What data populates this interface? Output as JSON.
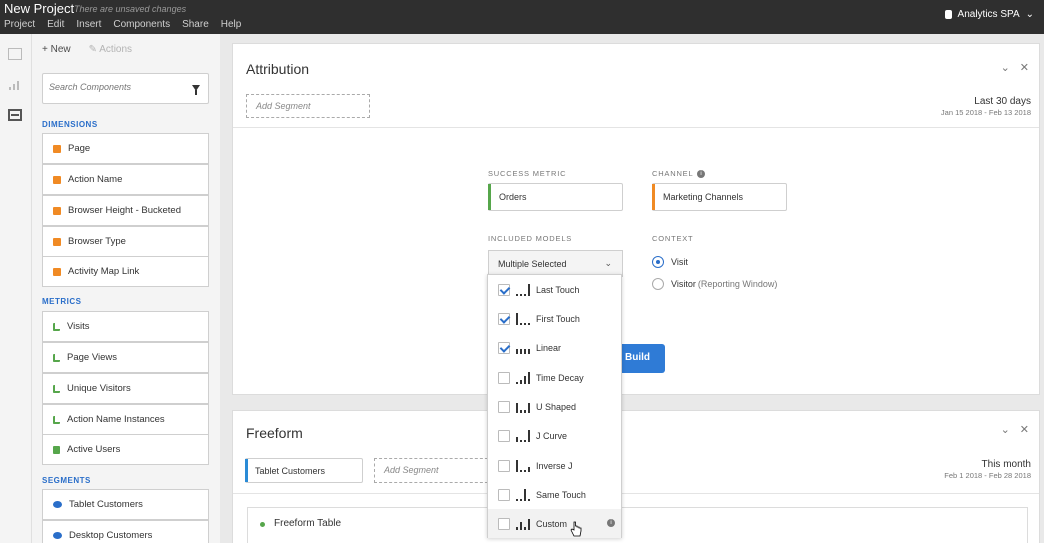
{
  "topbar": {
    "title": "New Project",
    "unsaved": "There are unsaved changes",
    "menu": [
      "Project",
      "Edit",
      "Insert",
      "Components",
      "Share",
      "Help"
    ],
    "suite": "Analytics SPA"
  },
  "panel": {
    "new_label": "New",
    "actions_label": "Actions",
    "search_placeholder": "Search Components",
    "dimensions_header": "DIMENSIONS",
    "dimensions": [
      "Page",
      "Action Name",
      "Browser Height - Bucketed",
      "Browser Type",
      "Activity Map Link"
    ],
    "metrics_header": "METRICS",
    "metrics": [
      "Visits",
      "Page Views",
      "Unique Visitors",
      "Action Name Instances",
      "Active Users"
    ],
    "segments_header": "SEGMENTS",
    "segments": [
      "Tablet Customers",
      "Desktop Customers"
    ]
  },
  "attribution": {
    "title": "Attribution",
    "add_segment": "Add Segment",
    "date_title": "Last 30 days",
    "date_range": "Jan 15 2018 - Feb 13 2018",
    "success_metric_label": "SUCCESS METRIC",
    "success_metric": "Orders",
    "channel_label": "CHANNEL",
    "channel": "Marketing Channels",
    "included_models_label": "INCLUDED MODELS",
    "models_select": "Multiple Selected",
    "context_label": "CONTEXT",
    "context_visit": "Visit",
    "context_visitor": "Visitor",
    "context_visitor_note": "(Reporting Window)",
    "build_label": "Build",
    "models": [
      {
        "label": "Last Touch",
        "checked": true
      },
      {
        "label": "First Touch",
        "checked": true
      },
      {
        "label": "Linear",
        "checked": true
      },
      {
        "label": "Time Decay",
        "checked": false
      },
      {
        "label": "U Shaped",
        "checked": false
      },
      {
        "label": "J Curve",
        "checked": false
      },
      {
        "label": "Inverse J",
        "checked": false
      },
      {
        "label": "Same Touch",
        "checked": false
      },
      {
        "label": "Custom",
        "checked": false
      }
    ]
  },
  "freeform": {
    "title": "Freeform",
    "segment_chip": "Tablet Customers",
    "add_segment": "Add Segment",
    "date_title": "This month",
    "date_range": "Feb 1 2018 - Feb 28 2018",
    "table_title": "Freeform Table"
  },
  "icons": {
    "collapse": "chevron-down-icon",
    "close": "close-icon",
    "info": "info-icon"
  },
  "colors": {
    "accent": "#2a6ec9",
    "build_button": "#2f7bd6",
    "dimension": "#f08a24",
    "metric": "#56a64b",
    "topbar": "#2f2f2f"
  }
}
